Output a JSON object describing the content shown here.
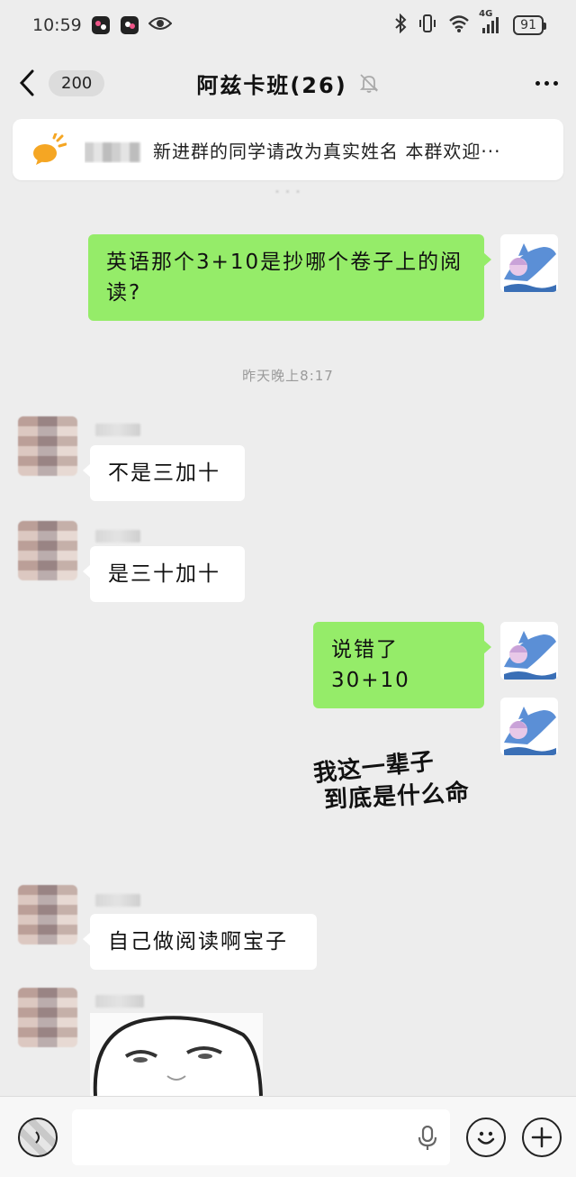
{
  "status_bar": {
    "time": "10:59",
    "network": "4G",
    "battery": "91"
  },
  "header": {
    "unread_count": "200",
    "title": "阿兹卡班(26)"
  },
  "announcement": {
    "text": "新进群的同学请改为真实姓名 本群欢迎···"
  },
  "messages": [
    {
      "sender": "me",
      "text": "英语那个3+10是抄哪个卷子上的阅读?"
    },
    {
      "type": "time",
      "text": "昨天晚上8:17"
    },
    {
      "sender": "other",
      "text": "不是三加十"
    },
    {
      "sender": "other",
      "text": "是三十加十"
    },
    {
      "sender": "me",
      "text": "说错了30+10"
    },
    {
      "sender": "me",
      "type": "sticker",
      "text_line1": "我这一辈子",
      "text_line2": "到底是什么命"
    },
    {
      "sender": "other",
      "text": "自己做阅读啊宝子"
    },
    {
      "sender": "other",
      "type": "sticker"
    }
  ],
  "colors": {
    "background": "#ededed",
    "my_bubble": "#95ec69",
    "other_bubble": "#ffffff",
    "announcement_icon": "#f5a623"
  }
}
